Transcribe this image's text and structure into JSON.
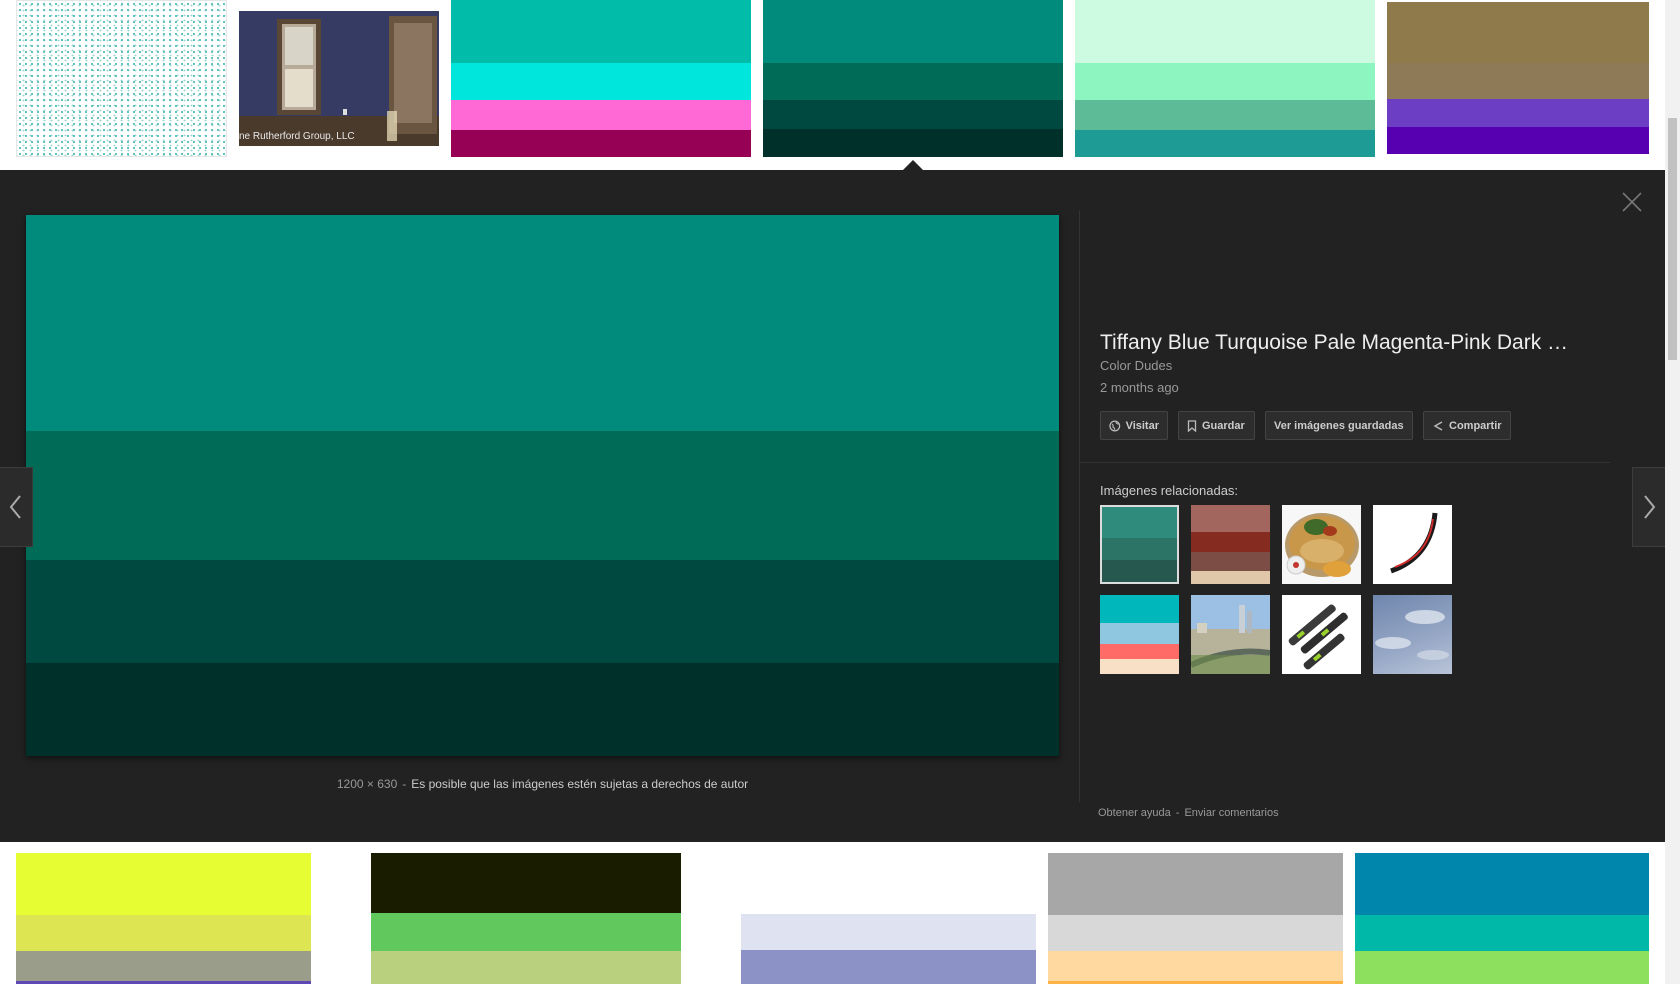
{
  "result": {
    "title": "Tiffany Blue Turquoise Pale Magenta-Pink Dark …",
    "source": "Color Dudes",
    "date": "2 months ago",
    "dimensions": "1200 × 630",
    "separator": "-",
    "copyright_notice": "Es posible que las imágenes estén sujetas a derechos de autor",
    "main_image_colors": [
      "#008b7d",
      "#006b56",
      "#004941",
      "#00302a"
    ],
    "main_image_stripe_fractions": [
      0.4,
      0.24,
      0.19,
      0.17
    ]
  },
  "actions": {
    "visit_label": "Visitar",
    "save_label": "Guardar",
    "view_saved_label": "Ver imágenes guardadas",
    "share_label": "Compartir"
  },
  "related": {
    "label": "Imágenes relacionadas:",
    "thumbs": [
      {
        "name": "teal palette",
        "colors": [
          "#2f8b7b",
          "#2c7566",
          "#27584f"
        ],
        "selected": true
      },
      {
        "name": "brown palette",
        "colors": [
          "#a2665f",
          "#852b1f",
          "#7b4d44",
          "#e0c7aa"
        ]
      },
      {
        "name": "food platter photo",
        "colors": [
          "#f5f5f5"
        ]
      },
      {
        "name": "bike rim photo",
        "colors": [
          "#ffffff"
        ]
      },
      {
        "name": "turquoise coral palette",
        "colors": [
          "#00b8bc",
          "#8fc6e0",
          "#ff6b66",
          "#f7e0c6"
        ]
      },
      {
        "name": "city highway photo",
        "colors": [
          "#9cb6d4"
        ]
      },
      {
        "name": "tool parts photo",
        "colors": [
          "#ffffff"
        ]
      },
      {
        "name": "sky photo",
        "colors": [
          "#7d92b8"
        ]
      }
    ]
  },
  "footer": {
    "help_label": "Obtener ayuda",
    "separator": "-",
    "feedback_label": "Enviar comentarios"
  },
  "top_row": {
    "photo_caption": "ne Rutherford Group, LLC",
    "tiles": [
      {
        "name": "pattern",
        "colors": [
          "#a9dcd7"
        ]
      },
      {
        "name": "photo",
        "colors": [
          "#3a3f66"
        ]
      },
      {
        "name": "palette-tiffany",
        "colors": [
          "#00bca8",
          "#00e5dc",
          "#ff69d5",
          "#960055"
        ]
      },
      {
        "name": "palette-teal-selected",
        "colors": [
          "#008b7d",
          "#006b56",
          "#004941",
          "#00302a"
        ]
      },
      {
        "name": "palette-mint",
        "colors": [
          "#cdfbe1",
          "#8df5bf",
          "#5ebb97",
          "#1f9b96"
        ]
      },
      {
        "name": "palette-olive-purple",
        "colors": [
          "#8f7a4c",
          "#8f7a58",
          "#6c3ec4",
          "#5700b2"
        ]
      }
    ]
  },
  "bottom_row": {
    "tiles": [
      {
        "name": "palette-lime",
        "colors": [
          "#e7fd33",
          "#dde552",
          "#9a9d8a",
          "#5e48b5"
        ]
      },
      {
        "name": "palette-dark-green",
        "colors": [
          "#1a1c00",
          "#60c85c",
          "#b9d17f"
        ]
      },
      {
        "name": "palette-lavender",
        "colors": [
          "#ffffff",
          "#dfe2f0",
          "#8d92c6"
        ]
      },
      {
        "name": "palette-grey-peach",
        "colors": [
          "#a7a7a7",
          "#d8d8d8",
          "#ffd9a0",
          "#ffb347"
        ]
      },
      {
        "name": "palette-ocean",
        "colors": [
          "#0085ad",
          "#00b8a8",
          "#8de05d"
        ]
      }
    ]
  },
  "colors": {
    "panel_bg": "#222222",
    "divider": "#333333",
    "title_text": "#eeeeee",
    "muted_text": "#999999"
  },
  "icons": {
    "close": "close-icon",
    "prev": "chevron-left-icon",
    "next": "chevron-right-icon",
    "visit": "globe-icon",
    "save": "bookmark-icon",
    "share": "share-icon"
  }
}
